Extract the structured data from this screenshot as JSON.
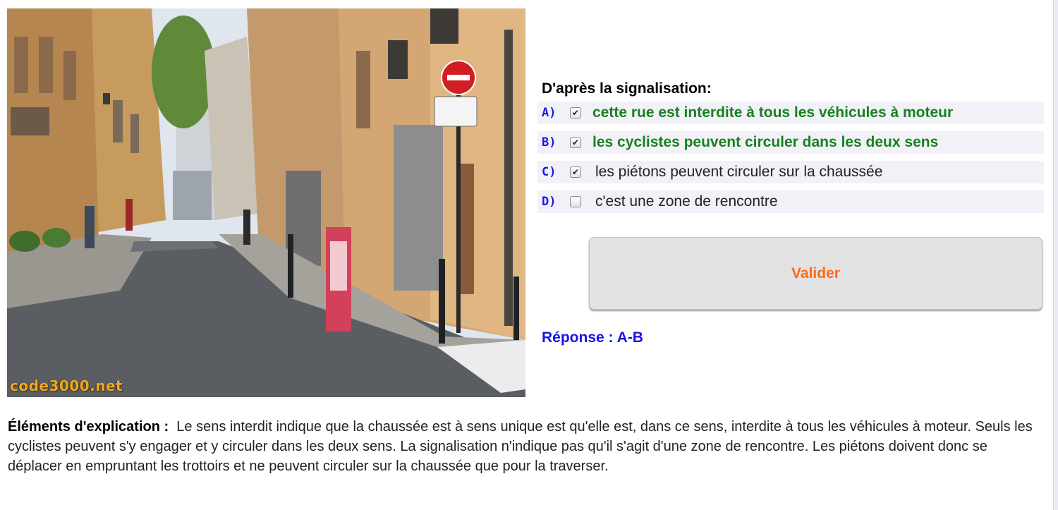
{
  "photo": {
    "watermark": "code3000.net"
  },
  "question": {
    "title": "D'après la signalisation:",
    "answers": [
      {
        "letter": "A)",
        "checked": true,
        "correct": true,
        "text": "cette rue est interdite à tous les véhicules à moteur"
      },
      {
        "letter": "B)",
        "checked": true,
        "correct": true,
        "text": "les cyclistes peuvent circuler dans les deux sens"
      },
      {
        "letter": "C)",
        "checked": true,
        "correct": false,
        "text": "les piétons peuvent circuler sur la chaussée"
      },
      {
        "letter": "D)",
        "checked": false,
        "correct": false,
        "text": "c'est une zone de rencontre"
      }
    ],
    "validate_label": "Valider",
    "response": "Réponse : A-B"
  },
  "explanation": {
    "label": "Éléments d'explication :",
    "text": "Le sens interdit indique que la chaussée est à sens unique est qu'elle est, dans ce sens, interdite à tous les véhicules à moteur. Seuls les cyclistes peuvent s'y engager et y circuler dans les deux sens. La signalisation n'indique pas qu'il s'agit d'une zone de rencontre. Les piétons doivent donc se déplacer en empruntant les trottoirs et ne peuvent circuler sur la chaussée que pour la traverser."
  },
  "colors": {
    "correct": "#17821d",
    "letter": "#1a1ae0",
    "validate_text": "#ff6a14",
    "response": "#1515e6",
    "row_background": "#f2f1f8"
  }
}
